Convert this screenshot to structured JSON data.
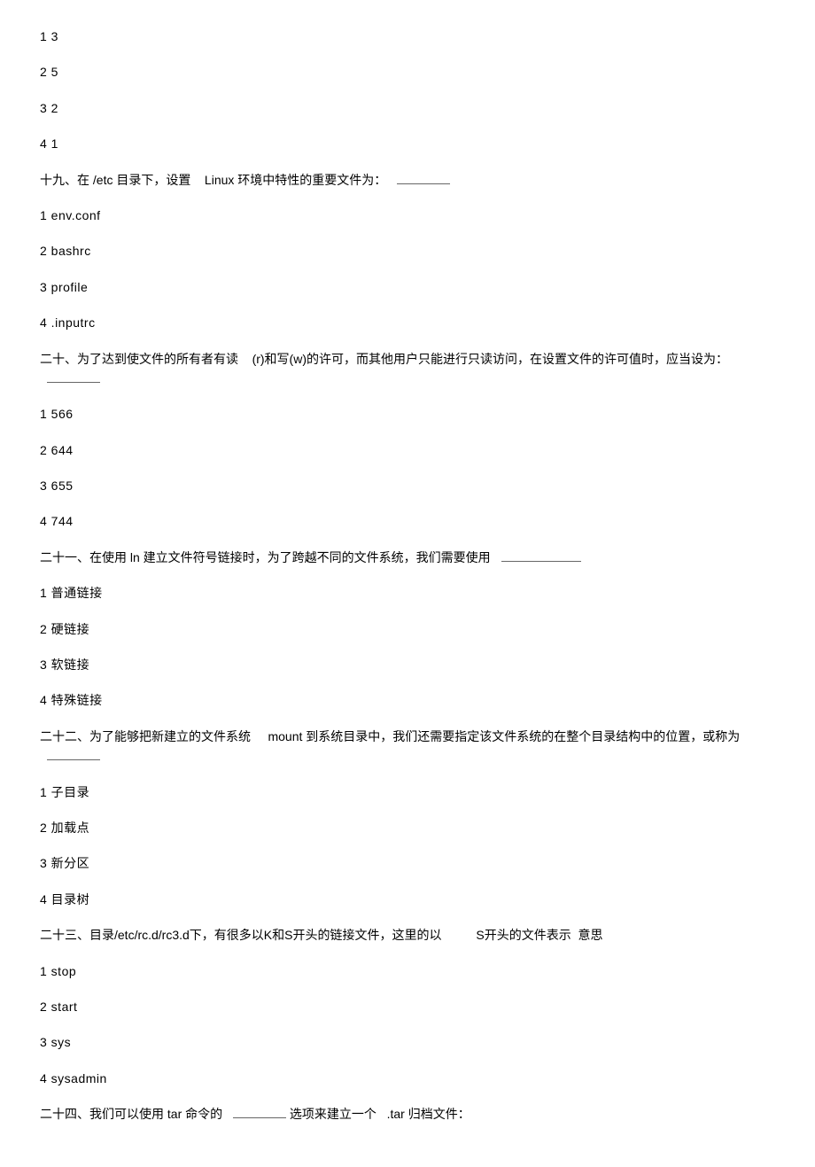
{
  "q18": {
    "opts": [
      "1  3",
      "2  5",
      "3  2",
      "4  1"
    ]
  },
  "q19": {
    "text_a": "十九、在",
    "text_b": "/etc 目录下，设置",
    "text_c": "Linux 环境中特性的重要文件为：",
    "opts": [
      "1  env.conf",
      "2  bashrc",
      "3  profile",
      "4  .inputrc"
    ]
  },
  "q20": {
    "text_a": "二十、为了达到使文件的所有者有读",
    "text_b": "(r)和写(w)的许可，而其他用户只能进行只读访问，在设置文件的许可值时，应当设为：",
    "opts": [
      "1  566",
      "2  644",
      "3  655",
      "4  744"
    ]
  },
  "q21": {
    "text_a": "二十一、在使用",
    "text_b": "ln 建立文件符号链接时，为了跨越不同的文件系统，我们需要使用",
    "opts": [
      "1  普通链接",
      "2  硬链接",
      "3  软链接",
      "4  特殊链接"
    ]
  },
  "q22": {
    "text_a": "二十二、为了能够把新建立的文件系统",
    "text_b": "mount 到系统目录中，我们还需要指定该文件系统的在整个目录结构中的位置，或称为",
    "opts": [
      "1  子目录",
      "2  加载点",
      "3  新分区",
      "4  目录树"
    ]
  },
  "q23": {
    "text_a": "二十三、目录/etc/rc.d/rc3.d下，有很多以K和S开头的链接文件，这里的以",
    "text_b": "S开头的文件表示",
    "text_c": "意思",
    "opts": [
      "1  stop",
      "2  start",
      "3  sys",
      "4  sysadmin"
    ]
  },
  "q24": {
    "text_a": "二十四、我们可以使用",
    "text_b": "tar 命令的",
    "text_c": "选项来建立一个",
    "text_d": ".tar 归档文件："
  }
}
